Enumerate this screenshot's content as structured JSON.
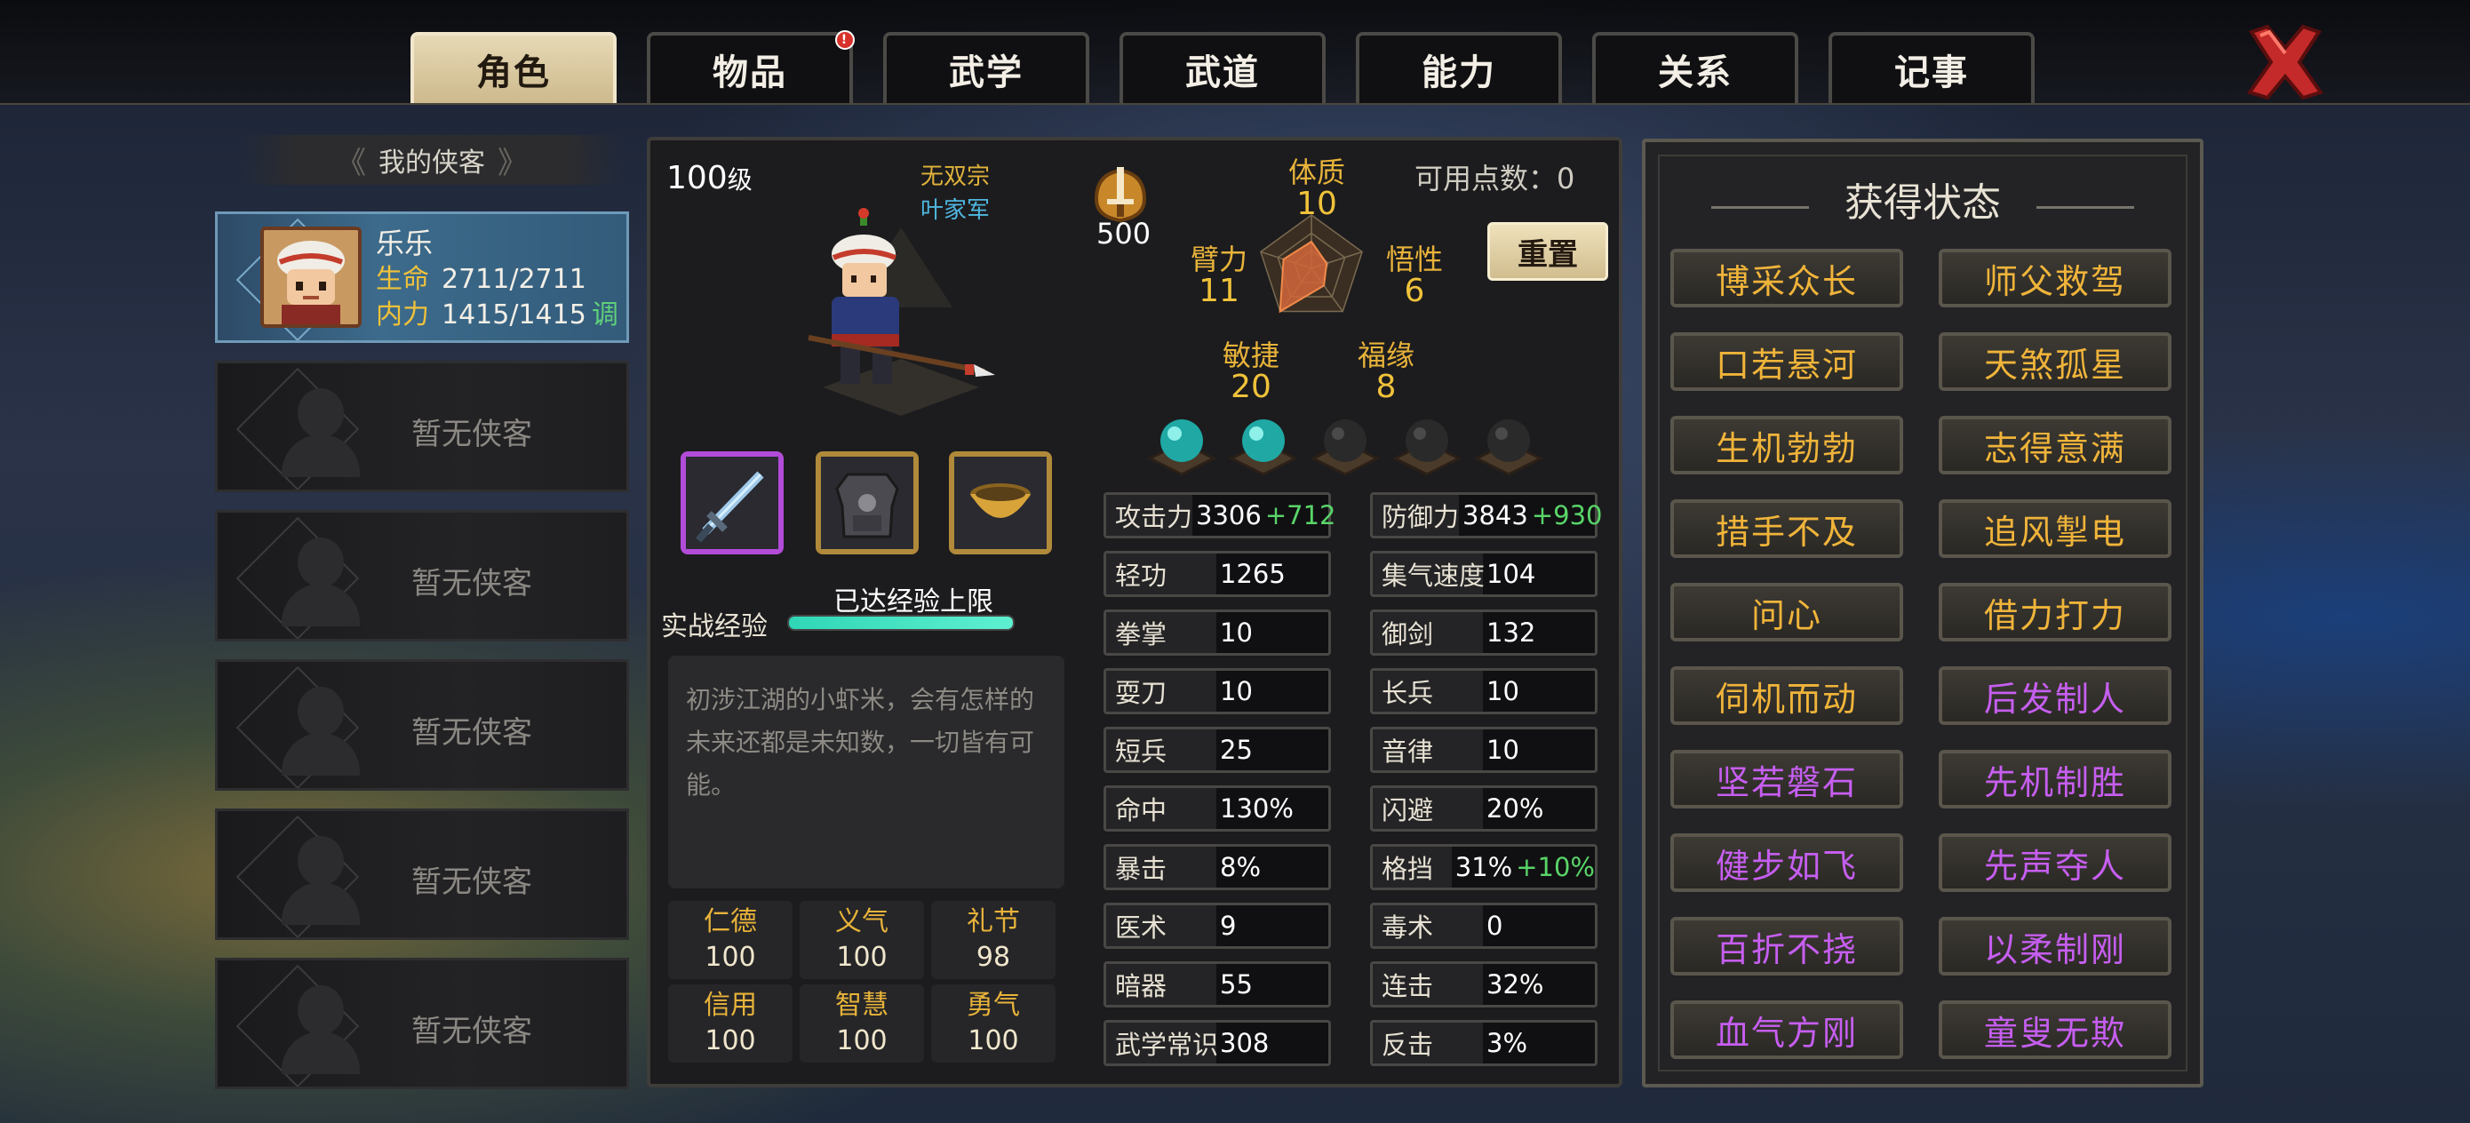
{
  "tabs": [
    {
      "label": "角色"
    },
    {
      "label": "物品",
      "badge": "!"
    },
    {
      "label": "武学"
    },
    {
      "label": "武道"
    },
    {
      "label": "能力"
    },
    {
      "label": "关系"
    },
    {
      "label": "记事"
    }
  ],
  "sidebar": {
    "title": "我的侠客",
    "selected": {
      "name": "乐乐",
      "hp_label": "生命",
      "hp": "2711/2711",
      "mp_label": "内力",
      "mp": "1415/1415",
      "adjust_label": "调"
    },
    "empty_slot_label": "暂无侠客",
    "empty_slots": [
      "暂无侠客",
      "暂无侠客",
      "暂无侠客",
      "暂无侠客",
      "暂无侠客"
    ]
  },
  "character": {
    "level": "100",
    "level_suffix": "级",
    "sect": "无双宗",
    "faction": "叶家军",
    "power": "500",
    "xp_label": "实战经验",
    "xp_cap_text": "已达经验上限",
    "xp_progress": 1.0,
    "description": "初涉江湖的小虾米，会有怎样的未来还都是未知数，一切皆有可能。",
    "equipment": [
      "sword-icon",
      "armor-icon",
      "bowl-icon"
    ],
    "virtues": [
      {
        "label": "仁德",
        "value": "100"
      },
      {
        "label": "义气",
        "value": "100"
      },
      {
        "label": "礼节",
        "value": "98"
      },
      {
        "label": "信用",
        "value": "100"
      },
      {
        "label": "智慧",
        "value": "100"
      },
      {
        "label": "勇气",
        "value": "100"
      }
    ]
  },
  "attributes": {
    "points_label": "可用点数：",
    "points": "0",
    "reset_label": "重置",
    "items": [
      {
        "label": "体质",
        "value": 10
      },
      {
        "label": "悟性",
        "value": 6
      },
      {
        "label": "福缘",
        "value": 8
      },
      {
        "label": "敏捷",
        "value": 20
      },
      {
        "label": "臂力",
        "value": 11
      }
    ],
    "gems": [
      "teal",
      "teal",
      "dark",
      "dark",
      "dark"
    ]
  },
  "stats": [
    {
      "label": "攻击力",
      "value": "3306",
      "bonus": "+712"
    },
    {
      "label": "防御力",
      "value": "3843",
      "bonus": "+930"
    },
    {
      "label": "轻功",
      "value": "1265",
      "bonus": ""
    },
    {
      "label": "集气速度",
      "value": "104",
      "bonus": ""
    },
    {
      "label": "拳掌",
      "value": "10",
      "bonus": ""
    },
    {
      "label": "御剑",
      "value": "132",
      "bonus": ""
    },
    {
      "label": "耍刀",
      "value": "10",
      "bonus": ""
    },
    {
      "label": "长兵",
      "value": "10",
      "bonus": ""
    },
    {
      "label": "短兵",
      "value": "25",
      "bonus": ""
    },
    {
      "label": "音律",
      "value": "10",
      "bonus": ""
    },
    {
      "label": "命中",
      "value": "130%",
      "bonus": ""
    },
    {
      "label": "闪避",
      "value": "20%",
      "bonus": ""
    },
    {
      "label": "暴击",
      "value": "8%",
      "bonus": ""
    },
    {
      "label": "格挡",
      "value": "31%",
      "bonus": "+10%"
    },
    {
      "label": "医术",
      "value": "9",
      "bonus": ""
    },
    {
      "label": "毒术",
      "value": "0",
      "bonus": ""
    },
    {
      "label": "暗器",
      "value": "55",
      "bonus": ""
    },
    {
      "label": "连击",
      "value": "32%",
      "bonus": ""
    },
    {
      "label": "武学常识",
      "value": "308",
      "bonus": ""
    },
    {
      "label": "反击",
      "value": "3%",
      "bonus": ""
    }
  ],
  "status_panel": {
    "title": "获得状态",
    "items": [
      {
        "label": "博采众长",
        "color": "gold"
      },
      {
        "label": "师父救驾",
        "color": "gold"
      },
      {
        "label": "口若悬河",
        "color": "gold"
      },
      {
        "label": "天煞孤星",
        "color": "gold"
      },
      {
        "label": "生机勃勃",
        "color": "gold"
      },
      {
        "label": "志得意满",
        "color": "gold"
      },
      {
        "label": "措手不及",
        "color": "gold"
      },
      {
        "label": "追风掣电",
        "color": "gold"
      },
      {
        "label": "问心",
        "color": "gold"
      },
      {
        "label": "借力打力",
        "color": "gold"
      },
      {
        "label": "伺机而动",
        "color": "gold"
      },
      {
        "label": "后发制人",
        "color": "purple"
      },
      {
        "label": "坚若磐石",
        "color": "purple"
      },
      {
        "label": "先机制胜",
        "color": "purple"
      },
      {
        "label": "健步如飞",
        "color": "purple"
      },
      {
        "label": "先声夺人",
        "color": "purple"
      },
      {
        "label": "百折不挠",
        "color": "purple"
      },
      {
        "label": "以柔制刚",
        "color": "purple"
      },
      {
        "label": "血气方刚",
        "color": "purple"
      },
      {
        "label": "童叟无欺",
        "color": "purple"
      }
    ]
  },
  "colors": {
    "gold": "#f0b43a",
    "purple": "#c65ef0",
    "bonus_green": "#59d468",
    "tab_active": "#e7d9b6"
  }
}
